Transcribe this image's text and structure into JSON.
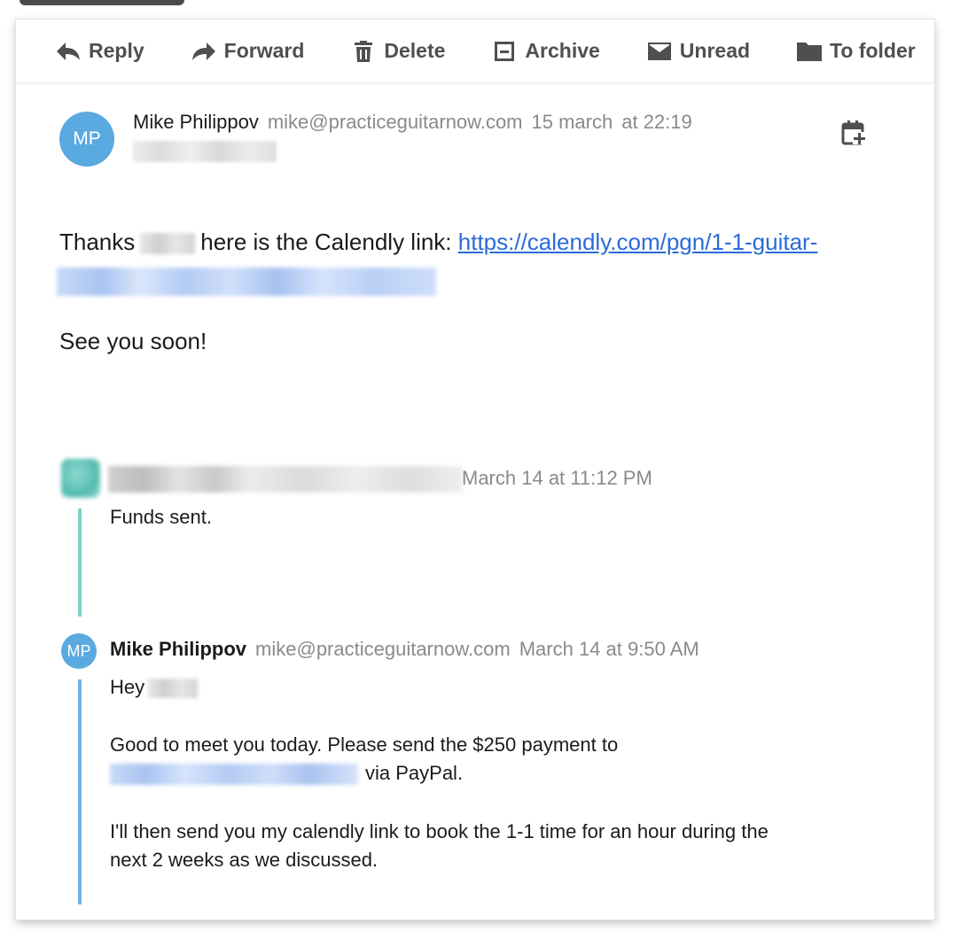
{
  "toolbar": {
    "reply_label": "Reply",
    "forward_label": "Forward",
    "delete_label": "Delete",
    "archive_label": "Archive",
    "unread_label": "Unread",
    "folder_label": "To folder"
  },
  "message": {
    "avatar_initials": "MP",
    "sender_name": "Mike Philippov",
    "sender_email": "mike@practiceguitarnow.com",
    "date": "15 march",
    "time": "at 22:19",
    "body_thanks": "Thanks",
    "body_here": "here is the Calendly link:",
    "link_text": "https://calendly.com/pgn/1-1-guitar-",
    "body_soon": "See you soon!"
  },
  "quote1": {
    "date": "March 14 at 11:12 PM",
    "text": "Funds sent."
  },
  "quote2": {
    "avatar_initials": "MP",
    "sender_name": "Mike Philippov",
    "sender_email": "mike@practiceguitarnow.com",
    "date": "March 14 at 9:50 AM",
    "hey": "Hey",
    "p1_line1": "Good to meet you today. Please send the $250 payment to",
    "p1_line2": "via PayPal.",
    "p2_line1": "I'll then send you my calendly link to book the 1-1 time for an hour during the",
    "p2_line2": "next 2 weeks as we discussed."
  },
  "colors": {
    "avatar": "#5aa9e0",
    "link": "#2a6bd8",
    "quote_bar_teal": "#7fcfc5",
    "quote_bar_blue": "#6fb0e3",
    "muted_text": "#8a8a8a"
  },
  "icons": [
    "reply-icon",
    "forward-icon",
    "trash-icon",
    "archive-icon",
    "envelope-icon",
    "folder-icon",
    "calendar-add-icon"
  ]
}
